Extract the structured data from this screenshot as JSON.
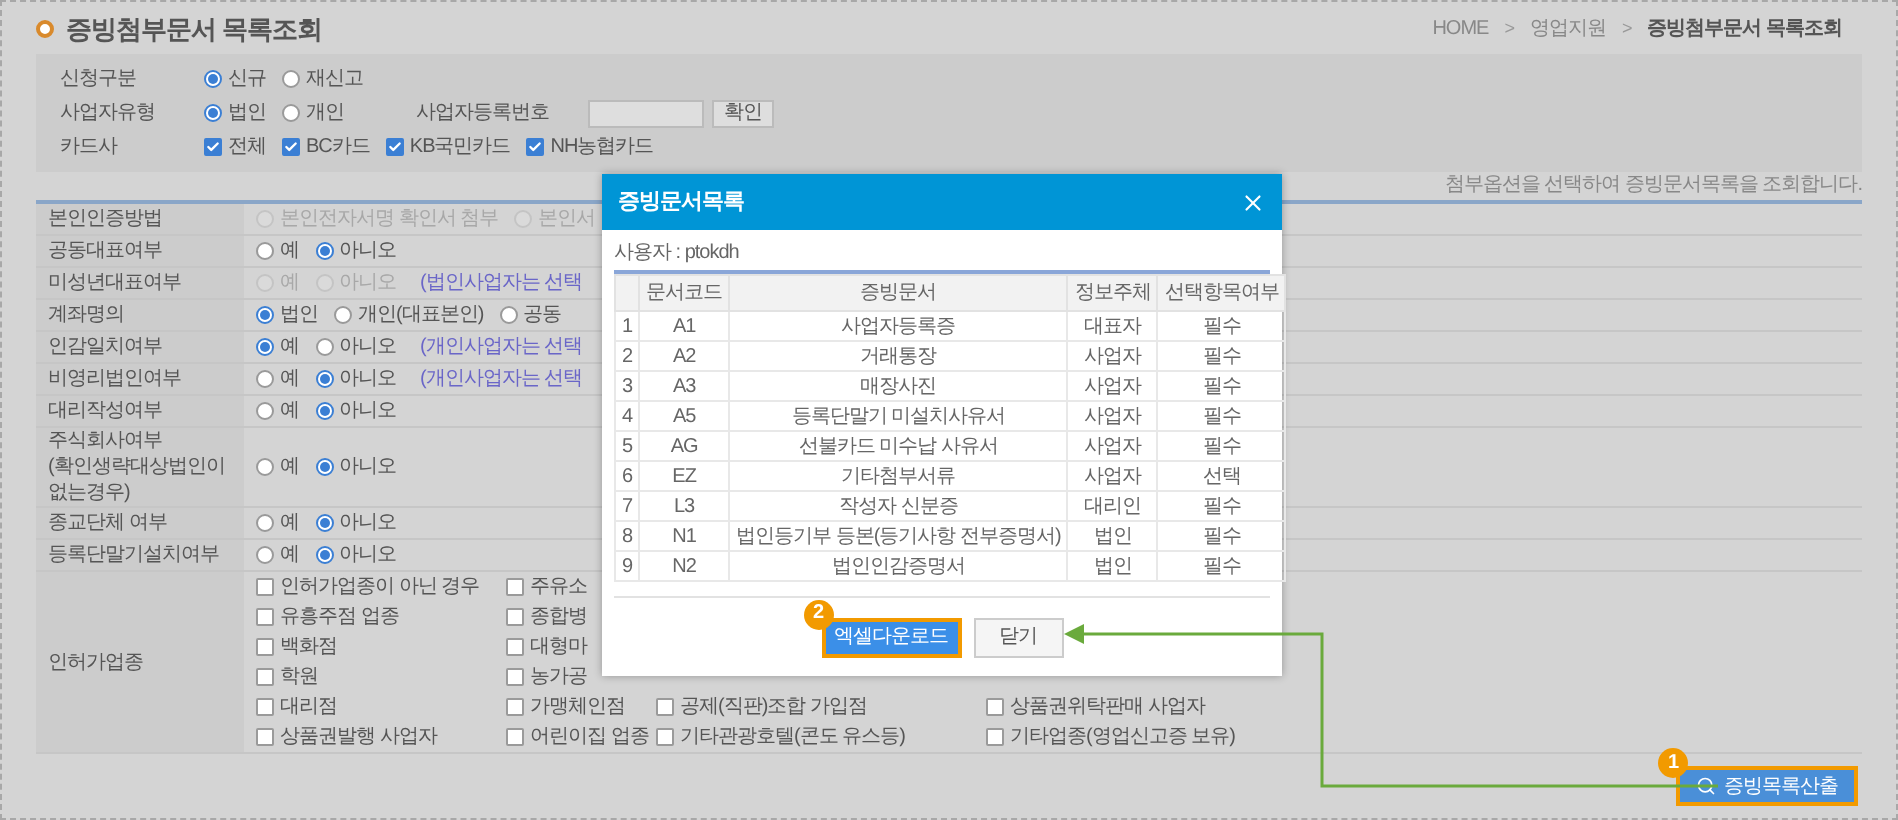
{
  "page": {
    "title": "증빙첨부문서 목록조회"
  },
  "breadcrumb": {
    "items": [
      "HOME",
      "영업지원",
      "증빙첨부문서 목록조회"
    ],
    "separator": ">"
  },
  "search_form": {
    "rows": [
      {
        "label": "신청구분",
        "kind": "radio",
        "options": [
          {
            "label": "신규",
            "selected": true
          },
          {
            "label": "재신고",
            "selected": false
          }
        ]
      },
      {
        "label": "사업자유형",
        "kind": "radio",
        "options": [
          {
            "label": "법인",
            "selected": true
          },
          {
            "label": "개인",
            "selected": false
          }
        ],
        "field": {
          "label": "사업자등록번호",
          "button": "확인"
        }
      },
      {
        "label": "카드사",
        "kind": "checkbox",
        "options": [
          {
            "label": "전체",
            "checked": true
          },
          {
            "label": "BC카드",
            "checked": true
          },
          {
            "label": "KB국민카드",
            "checked": true
          },
          {
            "label": "NH농협카드",
            "checked": true
          }
        ]
      }
    ]
  },
  "hint": "첨부옵션을 선택하여 증빙문서목록을 조회합니다.",
  "options_table": {
    "rows": [
      {
        "label": "본인인증방법",
        "kind": "radio",
        "disabled": true,
        "options": [
          {
            "label": "본인전자서명 확인서 첨부",
            "selected": false
          },
          {
            "label": "본인서",
            "selected": false
          }
        ]
      },
      {
        "label": "공동대표여부",
        "kind": "radio",
        "disabled": false,
        "options": [
          {
            "label": "예",
            "selected": false
          },
          {
            "label": "아니오",
            "selected": true
          }
        ]
      },
      {
        "label": "미성년대표여부",
        "kind": "radio",
        "disabled": true,
        "options": [
          {
            "label": "예",
            "selected": false
          },
          {
            "label": "아니오",
            "selected": false
          }
        ],
        "note": "(법인사업자는 선택"
      },
      {
        "label": "계좌명의",
        "kind": "radio",
        "disabled": false,
        "options": [
          {
            "label": "법인",
            "selected": true
          },
          {
            "label": "개인(대표본인)",
            "selected": false
          },
          {
            "label": "공동",
            "selected": false
          }
        ]
      },
      {
        "label": "인감일치여부",
        "kind": "radio",
        "disabled": false,
        "options": [
          {
            "label": "예",
            "selected": true
          },
          {
            "label": "아니오",
            "selected": false
          }
        ],
        "note": "(개인사업자는 선택"
      },
      {
        "label": "비영리법인여부",
        "kind": "radio",
        "disabled": false,
        "options": [
          {
            "label": "예",
            "selected": false
          },
          {
            "label": "아니오",
            "selected": true
          }
        ],
        "note": "(개인사업자는 선택"
      },
      {
        "label": "대리작성여부",
        "kind": "radio",
        "disabled": false,
        "options": [
          {
            "label": "예",
            "selected": false
          },
          {
            "label": "아니오",
            "selected": true
          }
        ]
      },
      {
        "label": "주식회사여부",
        "sublabel": "(확인생략대상법인이 없는경우)",
        "kind": "radio",
        "disabled": false,
        "options": [
          {
            "label": "예",
            "selected": false
          },
          {
            "label": "아니오",
            "selected": true
          }
        ]
      },
      {
        "label": "종교단체 여부",
        "kind": "radio",
        "disabled": false,
        "options": [
          {
            "label": "예",
            "selected": false
          },
          {
            "label": "아니오",
            "selected": true
          }
        ]
      },
      {
        "label": "등록단말기설치여부",
        "kind": "radio",
        "disabled": false,
        "options": [
          {
            "label": "예",
            "selected": false
          },
          {
            "label": "아니오",
            "selected": true
          }
        ]
      },
      {
        "label": "인허가업종",
        "kind": "checkbox_grid",
        "disabled": false,
        "option_rows": [
          [
            {
              "label": "인허가업종이 아닌 경우",
              "checked": false
            },
            {
              "label": "주유소",
              "checked": false
            }
          ],
          [
            {
              "label": "유흥주점 업종",
              "checked": false
            },
            {
              "label": "종합병",
              "checked": false
            }
          ],
          [
            {
              "label": "백화점",
              "checked": false
            },
            {
              "label": "대형마",
              "checked": false
            }
          ],
          [
            {
              "label": "학원",
              "checked": false
            },
            {
              "label": "농가공",
              "checked": false
            }
          ],
          [
            {
              "label": "대리점",
              "checked": false
            },
            {
              "label": "가맹체인점",
              "checked": false
            },
            {
              "label": "공제(직판)조합 가입점",
              "checked": false
            },
            {
              "label": "상품권위탁판매 사업자",
              "checked": false
            }
          ],
          [
            {
              "label": "상품권발행 사업자",
              "checked": false
            },
            {
              "label": "어린이집 업종",
              "checked": false
            },
            {
              "label": "기타관광호텔(콘도 유스등)",
              "checked": false
            },
            {
              "label": "기타업종(영업신고증 보유)",
              "checked": false
            }
          ]
        ]
      }
    ]
  },
  "action_button": {
    "label": "증빙목록산출",
    "badge": "1"
  },
  "dialog": {
    "title": "증빙문서목록",
    "user": "사용자 : ptokdh",
    "columns": [
      "문서코드",
      "증빙문서",
      "정보주체",
      "선택항목여부"
    ],
    "rows": [
      {
        "no": "1",
        "code": "A1",
        "document": "사업자등록증",
        "subject": "대표자",
        "required": "필수"
      },
      {
        "no": "2",
        "code": "A2",
        "document": "거래통장",
        "subject": "사업자",
        "required": "필수"
      },
      {
        "no": "3",
        "code": "A3",
        "document": "매장사진",
        "subject": "사업자",
        "required": "필수"
      },
      {
        "no": "4",
        "code": "A5",
        "document": "등록단말기 미설치사유서",
        "subject": "사업자",
        "required": "필수"
      },
      {
        "no": "5",
        "code": "AG",
        "document": "선불카드 미수납 사유서",
        "subject": "사업자",
        "required": "필수"
      },
      {
        "no": "6",
        "code": "EZ",
        "document": "기타첨부서류",
        "subject": "사업자",
        "required": "선택"
      },
      {
        "no": "7",
        "code": "L3",
        "document": "작성자 신분증",
        "subject": "대리인",
        "required": "필수"
      },
      {
        "no": "8",
        "code": "N1",
        "document": "법인등기부 등본(등기사항 전부증명서)",
        "subject": "법인",
        "required": "필수"
      },
      {
        "no": "9",
        "code": "N2",
        "document": "법인인감증명서",
        "subject": "법인",
        "required": "필수"
      }
    ],
    "buttons": [
      {
        "label": "엑셀다운로드",
        "kind": "primary",
        "badge": "2"
      },
      {
        "label": "닫기",
        "kind": "secondary"
      }
    ]
  }
}
